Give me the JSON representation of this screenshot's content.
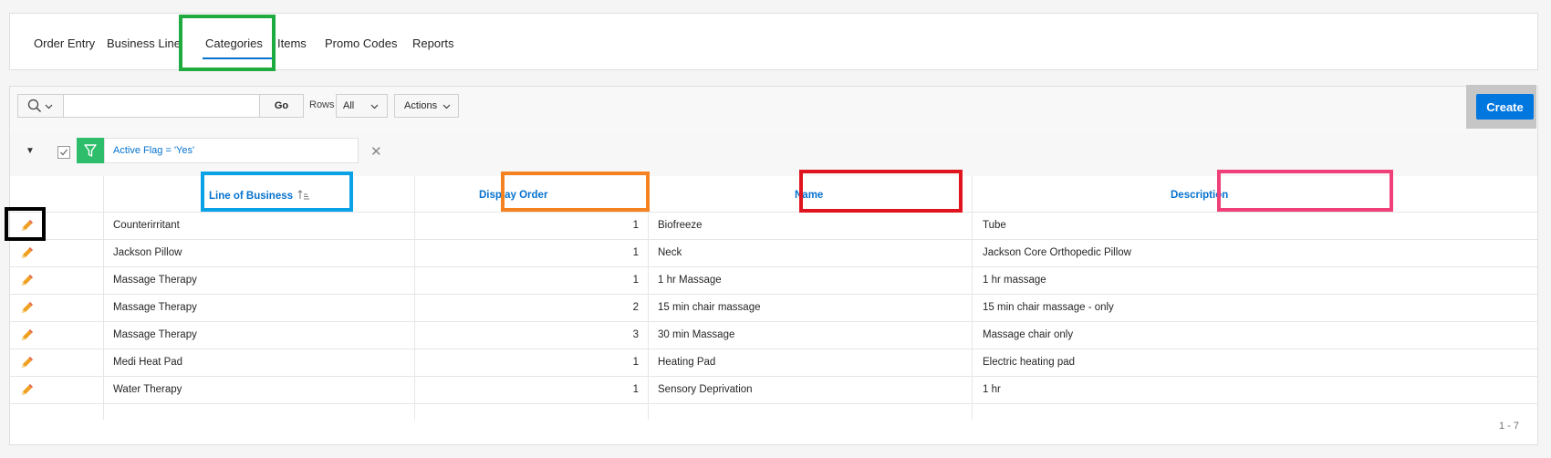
{
  "tabs": [
    {
      "label": "Order Entry"
    },
    {
      "label": "Business Line"
    },
    {
      "label": "Categories",
      "active": true
    },
    {
      "label": "Items"
    },
    {
      "label": "Promo Codes"
    },
    {
      "label": "Reports"
    }
  ],
  "toolbar": {
    "search_value": "",
    "go_label": "Go",
    "rows_label": "Rows",
    "rows_value": "All",
    "actions_label": "Actions",
    "create_label": "Create"
  },
  "filter": {
    "text": "Active Flag = 'Yes'",
    "checked": true
  },
  "table": {
    "headers": {
      "line_of_business": "Line of Business",
      "display_order": "Display Order",
      "name": "Name",
      "description": "Description"
    },
    "rows": [
      {
        "line_of_business": "Counterirritant",
        "display_order": "1",
        "name": "Biofreeze",
        "description": "Tube"
      },
      {
        "line_of_business": "Jackson Pillow",
        "display_order": "1",
        "name": "Neck",
        "description": "Jackson Core Orthopedic Pillow"
      },
      {
        "line_of_business": "Massage Therapy",
        "display_order": "1",
        "name": "1 hr Massage",
        "description": "1 hr massage"
      },
      {
        "line_of_business": "Massage Therapy",
        "display_order": "2",
        "name": "15 min chair massage",
        "description": "15 min chair massage - only"
      },
      {
        "line_of_business": "Massage Therapy",
        "display_order": "3",
        "name": "30 min Massage",
        "description": "Massage chair only"
      },
      {
        "line_of_business": "Medi Heat Pad",
        "display_order": "1",
        "name": "Heating Pad",
        "description": "Electric heating pad"
      },
      {
        "line_of_business": "Water Therapy",
        "display_order": "1",
        "name": "Sensory Deprivation",
        "description": "1 hr"
      }
    ],
    "pagination": "1 - 7"
  },
  "colors": {
    "accent": "#0572ce",
    "create_button": "#0076df",
    "filter_icon_bg": "#2ebd6b",
    "annotation_green": "#1fab3f",
    "annotation_blue": "#0aa2e6",
    "annotation_orange": "#f58220",
    "annotation_red": "#e0141e",
    "annotation_pink": "#f0407a",
    "annotation_black": "#000000"
  },
  "icons": [
    "search-icon",
    "chevron-down-icon",
    "filter-icon",
    "close-icon",
    "pencil-icon",
    "sort-ascending-icon",
    "caret-down-icon",
    "checkbox-icon"
  ]
}
